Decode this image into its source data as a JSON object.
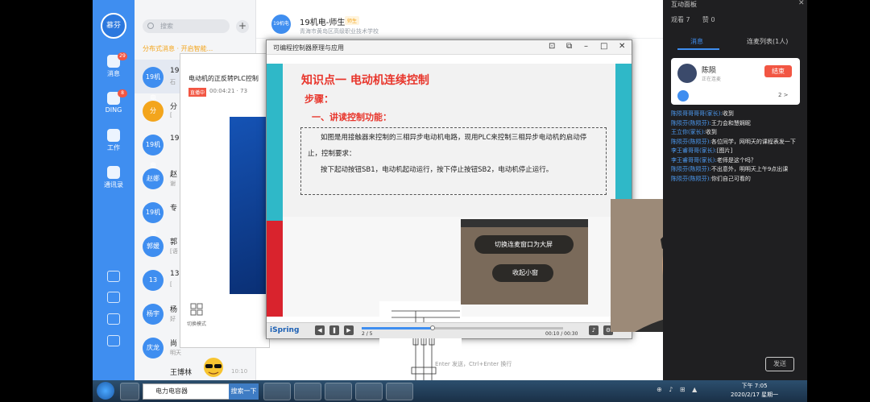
{
  "nav": {
    "avatar": "慕芬",
    "items": [
      {
        "label": "消息",
        "badge": "29"
      },
      {
        "label": "DING",
        "badge": "8"
      },
      {
        "label": "工作"
      },
      {
        "label": "通讯录"
      }
    ]
  },
  "chatlist": {
    "search_placeholder": "搜索",
    "add": "+",
    "notice": "分布式消息 · 开启智能...",
    "rows": [
      {
        "avatar": "19机电",
        "name": "19",
        "preview": "石",
        "time": ""
      },
      {
        "avatar": "分",
        "name": "分",
        "preview": "[",
        "time": ""
      },
      {
        "avatar": "19机电",
        "name": "19",
        "preview": "",
        "time": ""
      },
      {
        "avatar": "赵娜",
        "name": "赵",
        "preview": "谢",
        "time": ""
      },
      {
        "avatar": "19机电",
        "name": "专",
        "preview": "",
        "time": ""
      },
      {
        "avatar": "郭媛",
        "name": "郭",
        "preview": "[语",
        "time": ""
      },
      {
        "avatar": "13",
        "name": "13",
        "preview": "[",
        "time": ""
      },
      {
        "avatar": "杨宇",
        "name": "杨",
        "preview": "好",
        "time": ""
      },
      {
        "avatar": "庆龙",
        "name": "尚",
        "preview": "明天",
        "time": ""
      },
      {
        "avatar": "",
        "name": "王博林",
        "preview": "",
        "time": "10:10"
      }
    ]
  },
  "conversation": {
    "avatar": "19机电",
    "title": "19机电-师生",
    "tag": "师生",
    "subtitle": "青海市黄岛区高级职业技术学校",
    "input_hint": "Enter 发送，Ctrl+Enter 换行",
    "send_label": "发送"
  },
  "live": {
    "title": "互动面板",
    "close": "✕",
    "viewers_label": "观看 7",
    "likes_label": "赞 0",
    "tabs": [
      "消息",
      "连麦列表(1人)"
    ],
    "host": {
      "name": "陈陨",
      "sub": "正在连麦",
      "follow": "结束",
      "page": "2 >"
    },
    "comments": [
      {
        "who": "陈陨哥哥哥哥(家长):",
        "text": "收到"
      },
      {
        "who": "陈陨芬(陈陨芬):",
        "text": "王力会和慧娴昵"
      },
      {
        "who": "王立你(家长):",
        "text": "收到"
      },
      {
        "who": "陈陨芬(陈陨芬):",
        "text": "各位同学，网明天的课程表发一下"
      },
      {
        "who": "李王睿哥哥(家长):",
        "text": "[图片]"
      },
      {
        "who": "李王睿哥哥(家长):",
        "text": "老师是这个吗？"
      },
      {
        "who": "陈陨芬(陈陨芬):",
        "text": "不出意外，明明天上午9点出课"
      },
      {
        "who": "陈陨芬(陈陨芬):",
        "text": "你们自己可看的"
      }
    ]
  },
  "back_window": {
    "title": "电动机的正反转PLC控制",
    "badge": "直播中",
    "time": "00:04:21 · 73",
    "switch_label": "切换模式"
  },
  "ppt": {
    "window_title": "可编程控制器原理与应用",
    "heading": "知识点一    电动机连续控制",
    "step": "步骤：",
    "sub": "一、讲读控制功能：",
    "para1": "如图是用接触器来控制的三相异步电动机电路，现用PLC来控制三相异步电动机的启动停止，控制要求：",
    "para2": "按下起动按钮SB1，电动机起动运行，按下停止按钮SB2，电动机停止运行。",
    "logo": "iSpring",
    "slide_number": "2 / 5",
    "time_readout": "00:10 / 00:30",
    "progress": 0.35
  },
  "webcam": {
    "menu1": "切换连麦窗口为大屏",
    "menu2": "收起小窗"
  },
  "taskbar": {
    "search_text": "电力电容器",
    "search_button": "搜索一下",
    "time": "下午 7:05",
    "date": "2020/2/17 星期一"
  },
  "colors": {
    "dingtalk_blue": "#3f8ef0",
    "slide_red": "#e8352b",
    "slide_teal": "#2fb8c8",
    "live_bg": "#1f1f21"
  }
}
